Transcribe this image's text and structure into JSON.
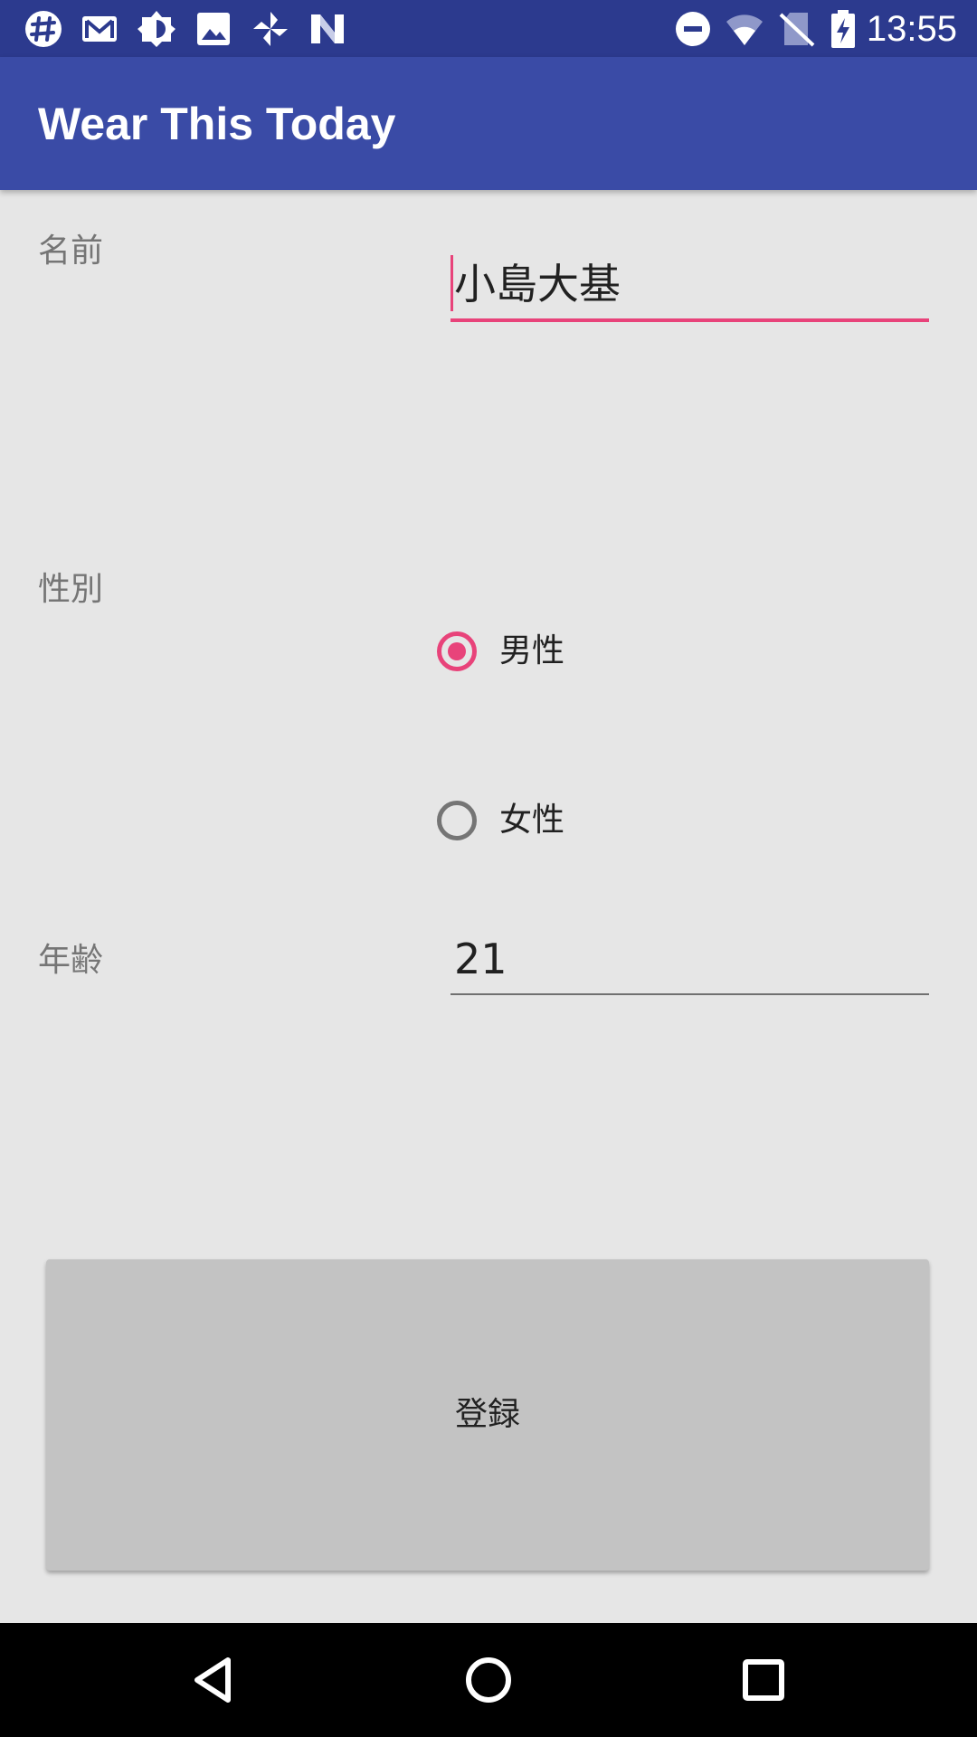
{
  "status_bar": {
    "time": "13:55",
    "left_icons": [
      "slack-icon",
      "gmail-icon",
      "brightness-icon",
      "photos-icon",
      "pinwheel-icon",
      "nfc-n-icon"
    ],
    "right_icons": [
      "dnd-icon",
      "wifi-icon",
      "no-sim-icon",
      "battery-charging-icon"
    ]
  },
  "app_bar": {
    "title": "Wear This Today"
  },
  "form": {
    "name": {
      "label": "名前",
      "value": "小島大基"
    },
    "gender": {
      "label": "性別",
      "options": [
        {
          "label": "男性",
          "checked": true
        },
        {
          "label": "女性",
          "checked": false
        }
      ]
    },
    "age": {
      "label": "年齢",
      "value": "21"
    },
    "submit_label": "登録"
  },
  "colors": {
    "status_bar": "#2c3a8e",
    "app_bar": "#3a4ba6",
    "accent": "#e8437a",
    "background": "#e6e6e6",
    "button": "#c3c3c3"
  },
  "nav_bar": {
    "icons": [
      "back-icon",
      "home-icon",
      "recents-icon"
    ]
  }
}
